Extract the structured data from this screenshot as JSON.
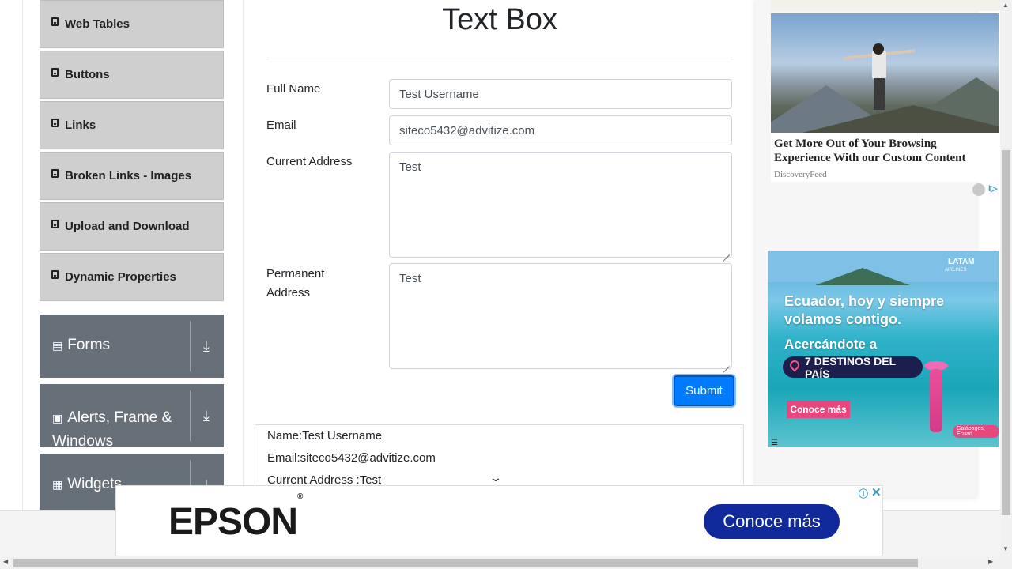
{
  "sidebar": {
    "items": [
      {
        "label": "Web Tables"
      },
      {
        "label": "Buttons"
      },
      {
        "label": "Links"
      },
      {
        "label": "Broken Links - Images"
      },
      {
        "label": "Upload and Download"
      },
      {
        "label": "Dynamic Properties"
      }
    ],
    "groups": [
      {
        "label": "Forms"
      },
      {
        "label": "Alerts, Frame &",
        "label2": "Windows"
      },
      {
        "label": "Widgets"
      }
    ]
  },
  "page": {
    "title": "Text Box"
  },
  "form": {
    "full_name_label": "Full Name",
    "full_name_value": "Test Username",
    "email_label": "Email",
    "email_value": "siteco5432@advitize.com",
    "current_address_label": "Current Address",
    "current_address_value": "Test",
    "permanent_address_label_1": "Permanent",
    "permanent_address_label_2": "Address",
    "permanent_address_value": "Test",
    "submit_label": "Submit"
  },
  "output": {
    "name": "Name:Test Username",
    "email": "Email:siteco5432@advitize.com",
    "current_address": "Current Address :Test"
  },
  "ads": {
    "discovery_headline": "Get More Out of Your Browsing Experience With our Custom Content",
    "discovery_source": "DiscoveryFeed",
    "latam_line1": "Ecuador, hoy y siempre",
    "latam_line2": "volamos contigo.",
    "latam_line3": "Acercándote a",
    "latam_pill": "7 DESTINOS DEL PAÍS",
    "latam_button": "Conoce más",
    "latam_logo": "LATAM",
    "latam_logo_sub": "AIRLINES",
    "latam_location": "Galápagos, Ecuad",
    "epson_brand": "EPSON",
    "epson_button": "Conoce más"
  },
  "colors": {
    "primary": "#007bff",
    "sidebar_group": "#676f79",
    "sidebar_item": "#cfcfcf",
    "epson_button": "#10299b"
  }
}
